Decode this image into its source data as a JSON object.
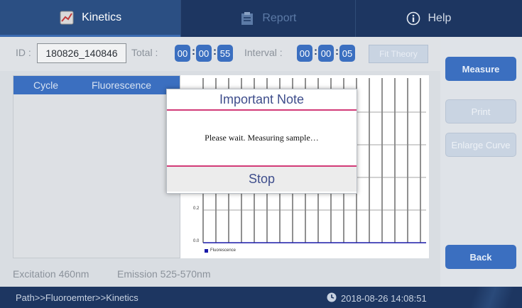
{
  "tabs": [
    {
      "label": "Kinetics",
      "icon": "chart-icon",
      "active": true
    },
    {
      "label": "Report",
      "icon": "clipboard-icon",
      "active": false
    },
    {
      "label": "Help",
      "icon": "info-icon",
      "active": false
    }
  ],
  "header": {
    "id_label": "ID :",
    "id_value": "180826_140846",
    "total_label": "Total :",
    "total": [
      "00",
      "00",
      "55"
    ],
    "interval_label": "Interval :",
    "interval": [
      "00",
      "00",
      "05"
    ],
    "ghost_button": "Fit Theory"
  },
  "table": {
    "columns": [
      "Cycle",
      "Fluorescence"
    ]
  },
  "chart": {
    "y_ticks": [
      "0.2",
      "0.0"
    ],
    "legend": "Fluorescence",
    "series_color": "#1a1aa8"
  },
  "footer": {
    "excitation": "Excitation 460nm",
    "emission": "Emission 525-570nm"
  },
  "side_buttons": {
    "measure": "Measure",
    "print": "Print",
    "enlarge": "Enlarge Curve",
    "back": "Back"
  },
  "status": {
    "path": "Path>>Fluoroemter>>Kinetics",
    "datetime": "2018-08-26 14:08:51"
  },
  "modal": {
    "title": "Important Note",
    "message": "Please wait. Measuring sample…",
    "stop": "Stop"
  },
  "colors": {
    "nav": "#1d3661",
    "accent": "#3b6fc0",
    "modal_rule": "#d23b77"
  }
}
